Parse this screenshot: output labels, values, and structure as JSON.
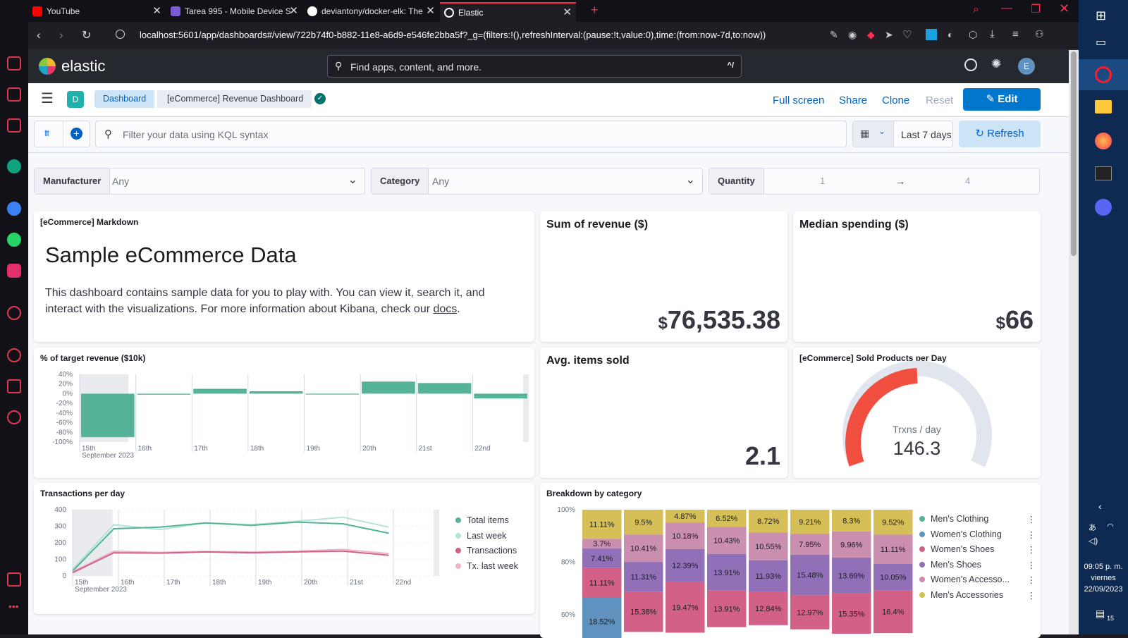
{
  "browser": {
    "tabs": [
      {
        "title": "YouTube",
        "color": "#ff0000"
      },
      {
        "title": "Tarea 995 - Mobile Device S",
        "color": "#7b5cd6"
      },
      {
        "title": "deviantony/docker-elk: The",
        "color": "#ffffff"
      },
      {
        "title": "Elastic",
        "color": "#ffffff"
      }
    ],
    "new_tab": "+",
    "url": "localhost:5601/app/dashboards#/view/722b74f0-b882-11e8-a6d9-e546fe2bba5f?_g=(filters:!(),refreshInterval:(pause:!t,value:0),time:(from:now-7d,to:now))"
  },
  "kibana": {
    "logo_text": "elastic",
    "search_placeholder": "Find apps, content, and more.",
    "search_shortcut": "^/",
    "avatar": "E",
    "space_badge": "D",
    "breadcrumbs": [
      "Dashboard",
      "[eCommerce] Revenue Dashboard"
    ],
    "actions": {
      "fullscreen": "Full screen",
      "share": "Share",
      "clone": "Clone",
      "reset": "Reset",
      "edit": "Edit"
    },
    "query_placeholder": "Filter your data using KQL syntax",
    "time_range": "Last 7 days",
    "refresh": "Refresh",
    "controls": {
      "manufacturer": {
        "label": "Manufacturer",
        "value": "Any"
      },
      "category": {
        "label": "Category",
        "value": "Any"
      },
      "quantity": {
        "label": "Quantity",
        "min": "1",
        "arrow": "→",
        "max": "4"
      }
    },
    "accent": "#0077cc"
  },
  "panels": {
    "markdown": {
      "title": "[eCommerce] Markdown",
      "heading": "Sample eCommerce Data",
      "body_1": "This dashboard contains sample data for you to play with. You can view it, search it, and interact with the visualizations. For more information about Kibana, check our",
      "link": "docs",
      "body_end": "."
    },
    "revenue": {
      "title": "Sum of revenue ($)",
      "currency": "$",
      "value": "76,535.38"
    },
    "median": {
      "title": "Median spending ($)",
      "currency": "$",
      "value": "66"
    },
    "avg_items": {
      "title": "Avg. items sold",
      "value": "2.1"
    },
    "gauge": {
      "title": "[eCommerce] Sold Products per Day",
      "label": "Trxns / day",
      "value": "146.3"
    },
    "target": {
      "title": "% of target revenue ($10k)"
    },
    "transactions": {
      "title": "Transactions per day"
    },
    "breakdown": {
      "title": "Breakdown by category"
    }
  },
  "chart_data": [
    {
      "id": "target",
      "type": "bar",
      "title": "% of target revenue ($10k)",
      "categories": [
        "15th",
        "16th",
        "17th",
        "18th",
        "19th",
        "20th",
        "21st",
        "22nd"
      ],
      "values": [
        -90,
        -2,
        10,
        5,
        -1,
        25,
        22,
        -10
      ],
      "y_ticks": [
        "40%",
        "20%",
        "0%",
        "-20%",
        "-40%",
        "-60%",
        "-80%",
        "-100%"
      ],
      "ylim": [
        -100,
        40
      ],
      "x_sublabel": "September 2023",
      "color": "#54b399"
    },
    {
      "id": "transactions",
      "type": "line",
      "title": "Transactions per day",
      "categories": [
        "15th",
        "16th",
        "17th",
        "18th",
        "19th",
        "20th",
        "21st",
        "22nd"
      ],
      "x_sublabel": "September 2023",
      "ylim": [
        0,
        400
      ],
      "y_ticks": [
        "400",
        "300",
        "200",
        "100",
        "0"
      ],
      "series": [
        {
          "name": "Total items",
          "color": "#54b399",
          "values": [
            30,
            285,
            295,
            320,
            305,
            325,
            315,
            258
          ]
        },
        {
          "name": "Last week",
          "color": "#b5e3d5",
          "values": [
            40,
            310,
            280,
            320,
            310,
            330,
            355,
            295
          ]
        },
        {
          "name": "Transactions",
          "color": "#d36086",
          "values": [
            20,
            140,
            138,
            145,
            140,
            145,
            150,
            125
          ]
        },
        {
          "name": "Tx. last week",
          "color": "#efb4c8",
          "values": [
            25,
            150,
            142,
            148,
            145,
            150,
            160,
            135
          ]
        }
      ]
    },
    {
      "id": "breakdown",
      "type": "bar",
      "stacked": true,
      "title": "Breakdown by category",
      "y_ticks": [
        "100%",
        "80%",
        "60%"
      ],
      "series_names": [
        "Men's Clothing",
        "Women's Clothing",
        "Women's Shoes",
        "Men's Shoes",
        "Women's Accesso...",
        "Men's Accessories"
      ],
      "colors": [
        "#54b399",
        "#6092c0",
        "#d36086",
        "#9170b8",
        "#ca8eae",
        "#d6bf57"
      ],
      "columns": [
        {
          "segments": [
            {
              "s": 5,
              "v": 11.11,
              "label": "11.11%"
            },
            {
              "s": 4,
              "v": 3.7,
              "label": "3.7%"
            },
            {
              "s": 3,
              "v": 7.41,
              "label": "7.41%"
            },
            {
              "s": 2,
              "v": 11.11,
              "label": "11.11%"
            },
            {
              "s": 1,
              "v": 18.52,
              "label": "18.52%"
            }
          ]
        },
        {
          "segments": [
            {
              "s": 5,
              "v": 9.5,
              "label": "9.5%"
            },
            {
              "s": 4,
              "v": 10.41,
              "label": "10.41%"
            },
            {
              "s": 3,
              "v": 11.31,
              "label": "11.31%"
            },
            {
              "s": 2,
              "v": 15.38,
              "label": "15.38%"
            }
          ]
        },
        {
          "segments": [
            {
              "s": 5,
              "v": 4.87,
              "label": "4.87%"
            },
            {
              "s": 4,
              "v": 10.18,
              "label": "10.18%"
            },
            {
              "s": 3,
              "v": 12.39,
              "label": "12.39%"
            },
            {
              "s": 2,
              "v": 19.47,
              "label": "19.47%"
            }
          ]
        },
        {
          "segments": [
            {
              "s": 5,
              "v": 6.52,
              "label": "6.52%"
            },
            {
              "s": 4,
              "v": 10.43,
              "label": "10.43%"
            },
            {
              "s": 3,
              "v": 13.91,
              "label": "13.91%"
            },
            {
              "s": 2,
              "v": 13.91,
              "label": "13.91%"
            }
          ]
        },
        {
          "segments": [
            {
              "s": 5,
              "v": 8.72,
              "label": "8.72%"
            },
            {
              "s": 4,
              "v": 10.55,
              "label": "10.55%"
            },
            {
              "s": 3,
              "v": 11.93,
              "label": "11.93%"
            },
            {
              "s": 2,
              "v": 12.84,
              "label": "12.84%"
            }
          ]
        },
        {
          "segments": [
            {
              "s": 5,
              "v": 9.21,
              "label": "9.21%"
            },
            {
              "s": 4,
              "v": 7.95,
              "label": "7.95%"
            },
            {
              "s": 3,
              "v": 15.48,
              "label": "15.48%"
            },
            {
              "s": 2,
              "v": 12.97,
              "label": "12.97%"
            }
          ]
        },
        {
          "segments": [
            {
              "s": 5,
              "v": 8.3,
              "label": "8.3%"
            },
            {
              "s": 4,
              "v": 9.96,
              "label": "9.96%"
            },
            {
              "s": 3,
              "v": 13.69,
              "label": "13.69%"
            },
            {
              "s": 2,
              "v": 15.35,
              "label": "15.35%"
            }
          ]
        },
        {
          "segments": [
            {
              "s": 5,
              "v": 9.52,
              "label": "9.52%"
            },
            {
              "s": 4,
              "v": 11.11,
              "label": "11.11%"
            },
            {
              "s": 3,
              "v": 10.05,
              "label": "10.05%"
            },
            {
              "s": 2,
              "v": 16.4,
              "label": "16.4%"
            }
          ]
        }
      ]
    }
  ],
  "taskbar": {
    "time": "09:05 p. m.",
    "day": "viernes",
    "date": "22/09/2023",
    "notifications": "15"
  }
}
